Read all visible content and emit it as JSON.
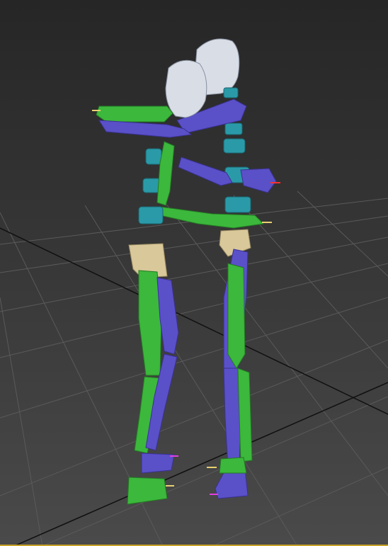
{
  "viewport": {
    "view": "perspective",
    "content": "biped-skeleton-pair",
    "colors": {
      "background_top": "#262626",
      "background_bottom": "#4a4a4a",
      "grid_line": "#5a5a5a",
      "grid_axis": "#101010",
      "bone_green": "#3cb83c",
      "bone_green_dark": "#237a23",
      "bone_blue": "#5a50c8",
      "bone_blue_dark": "#3a3290",
      "spine_cyan": "#2a9aa8",
      "spine_cyan_dark": "#1a6670",
      "head_white": "#d8dde6",
      "pelvis_tan": "#d8c89a",
      "frame_accent": "#c9a227"
    }
  }
}
